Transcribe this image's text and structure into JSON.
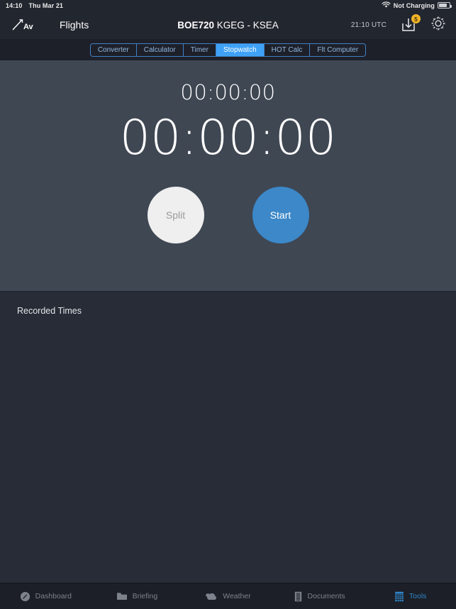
{
  "status_bar": {
    "time": "14:10",
    "date": "Thu Mar 21",
    "charging": "Not Charging",
    "wifi_icon": "wifi-icon",
    "battery_icon": "battery-icon"
  },
  "navbar": {
    "logo_text": "Av",
    "logo_icon": "aviation-arrow-icon",
    "flights_label": "Flights",
    "flight_number": "BOE720",
    "route": "KGEG - KSEA",
    "utc_time": "21:10 UTC",
    "download_icon": "download-tray-icon",
    "download_badge": "5",
    "settings_icon": "gear-icon"
  },
  "segments": {
    "items": [
      {
        "label": "Converter",
        "active": false
      },
      {
        "label": "Calculator",
        "active": false
      },
      {
        "label": "Timer",
        "active": false
      },
      {
        "label": "Stopwatch",
        "active": true
      },
      {
        "label": "HOT Calc",
        "active": false
      },
      {
        "label": "Flt Computer",
        "active": false
      }
    ]
  },
  "stopwatch": {
    "split_time": "00:00:00",
    "main_time": "00:00:00",
    "split_button": "Split",
    "start_button": "Start"
  },
  "recorded": {
    "title": "Recorded Times",
    "rows": []
  },
  "tabbar": {
    "items": [
      {
        "label": "Dashboard",
        "icon": "gauge-icon",
        "active": false
      },
      {
        "label": "Briefing",
        "icon": "folder-icon",
        "active": false
      },
      {
        "label": "Weather",
        "icon": "cloud-icon",
        "active": false
      },
      {
        "label": "Documents",
        "icon": "document-icon",
        "active": false
      },
      {
        "label": "Tools",
        "icon": "calculator-icon",
        "active": true
      }
    ]
  },
  "colors": {
    "accent_blue": "#3fa2f7",
    "tab_active": "#2f86c9",
    "panel_bg": "#3f4753",
    "page_bg": "#272c36",
    "nav_bg": "#22262e",
    "badge_yellow": "#f0b429"
  }
}
